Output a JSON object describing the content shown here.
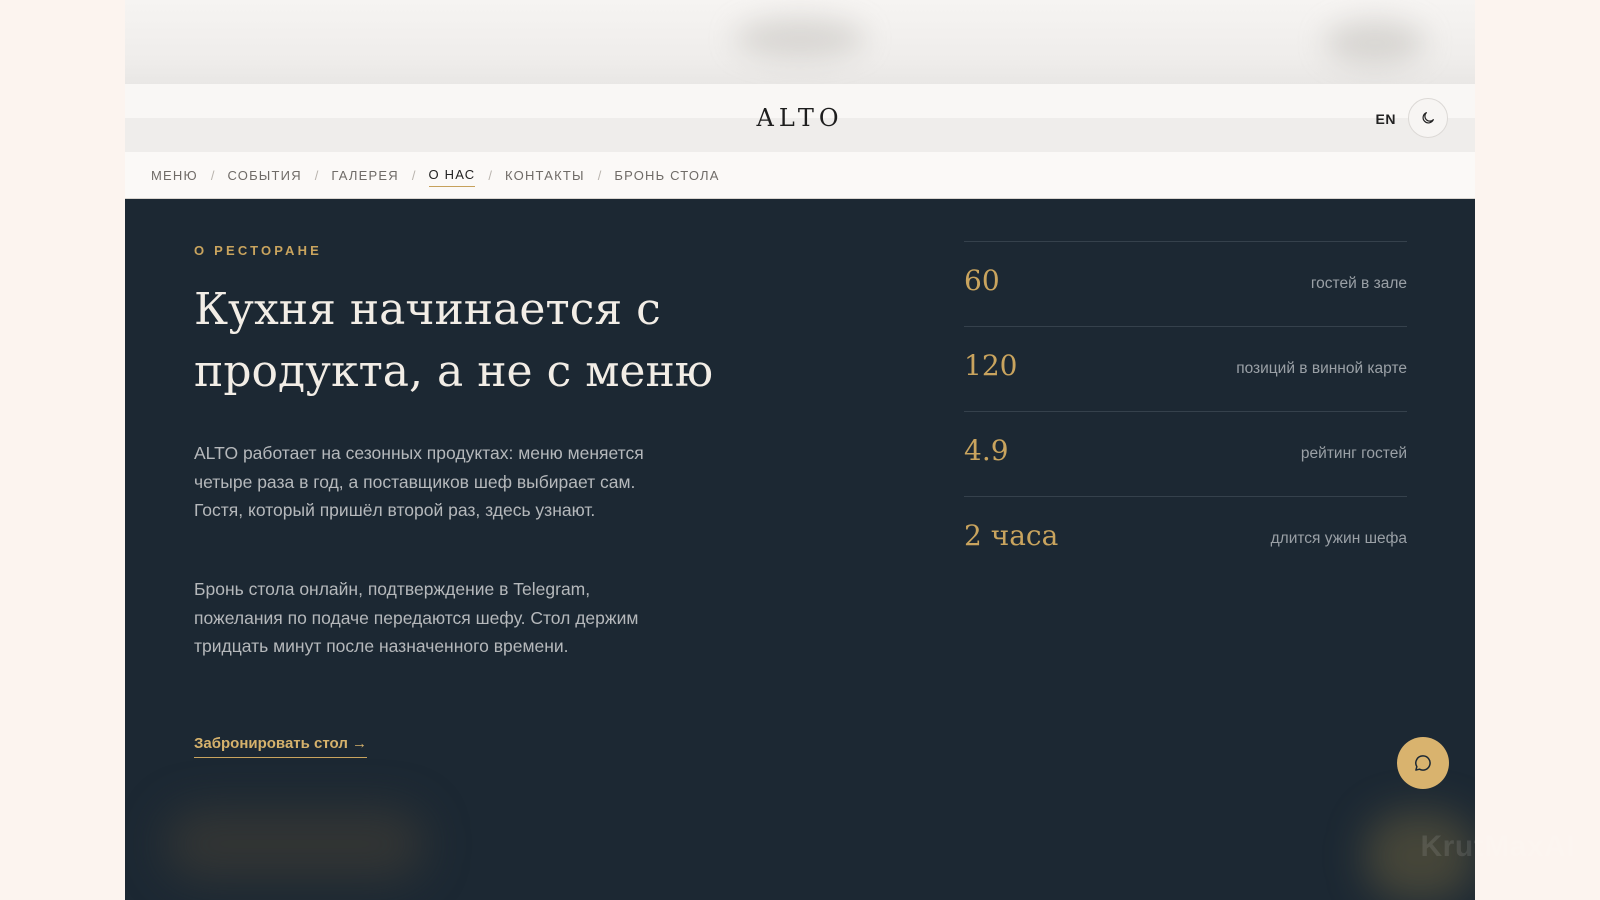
{
  "header": {
    "brand": "ALTO",
    "lang": "EN",
    "theme_icon": "moon-icon"
  },
  "nav": {
    "items": [
      {
        "label": "МЕНЮ"
      },
      {
        "label": "СОБЫТИЯ"
      },
      {
        "label": "ГАЛЕРЕЯ"
      },
      {
        "label": "О НАС",
        "active": true
      },
      {
        "label": "КОНТАКТЫ"
      },
      {
        "label": "БРОНЬ СТОЛА"
      }
    ],
    "separator": "/"
  },
  "about": {
    "eyebrow": "О РЕСТОРАНЕ",
    "headline": "Кухня начинается с продукта, а не с меню",
    "paragraphs": [
      "ALTO работает на сезонных продуктах: меню меняется четыре раза в год, а поставщиков шеф выбирает сам. Гостя, который пришёл второй раз, здесь узнают.",
      "Бронь стола онлайн, подтверждение в Telegram, пожелания по подаче передаются шефу. Стол держим тридцать минут после назначенного времени."
    ],
    "cta": "Забронировать стол →"
  },
  "stats": [
    {
      "value": "60",
      "label": "гостей в зале"
    },
    {
      "value": "120",
      "label": "позиций в винной карте"
    },
    {
      "value": "4.9",
      "label": "рейтинг гостей"
    },
    {
      "value": "2 часа",
      "label": "длится ужин шефа"
    }
  ],
  "chat": {
    "icon": "chat-bubble-icon"
  },
  "watermark": "KrutMaxAI",
  "colors": {
    "accent": "#c9a45e",
    "dark_bg": "#1c2833",
    "light_bg": "#fbf9f7"
  }
}
